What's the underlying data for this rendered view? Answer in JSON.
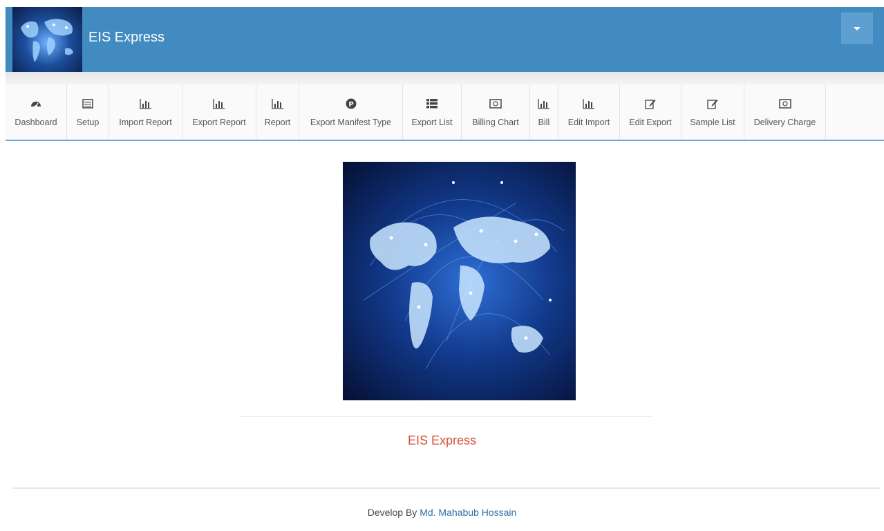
{
  "header": {
    "brand": "EIS Express",
    "logo_icon": "world-map-icon",
    "dropdown_icon": "caret-down-icon"
  },
  "nav": {
    "items": [
      {
        "label": "Dashboard",
        "icon": "dashboard-icon"
      },
      {
        "label": "Setup",
        "icon": "list-icon"
      },
      {
        "label": "Import Report",
        "icon": "bar-chart-icon"
      },
      {
        "label": "Export Report",
        "icon": "bar-chart-icon"
      },
      {
        "label": "Report",
        "icon": "bar-chart-icon"
      },
      {
        "label": "Export Manifest Type",
        "icon": "p-circle-icon"
      },
      {
        "label": "Export List",
        "icon": "list-icon"
      },
      {
        "label": "Billing Chart",
        "icon": "money-icon"
      },
      {
        "label": "Bill",
        "icon": "bar-chart-icon"
      },
      {
        "label": "Edit Import",
        "icon": "bar-chart-icon"
      },
      {
        "label": "Edit Export",
        "icon": "edit-icon"
      },
      {
        "label": "Sample List",
        "icon": "edit-icon"
      },
      {
        "label": "Delivery Charge",
        "icon": "money-icon"
      }
    ]
  },
  "main": {
    "hero_icon": "world-map-icon",
    "brand": "EIS Express"
  },
  "footer": {
    "prefix": "Develop By",
    "author": "Md. Mahabub Hossain"
  },
  "colors": {
    "header_bg": "#428bc0",
    "brand_red": "#d4523a",
    "link_blue": "#2d6ea8"
  }
}
